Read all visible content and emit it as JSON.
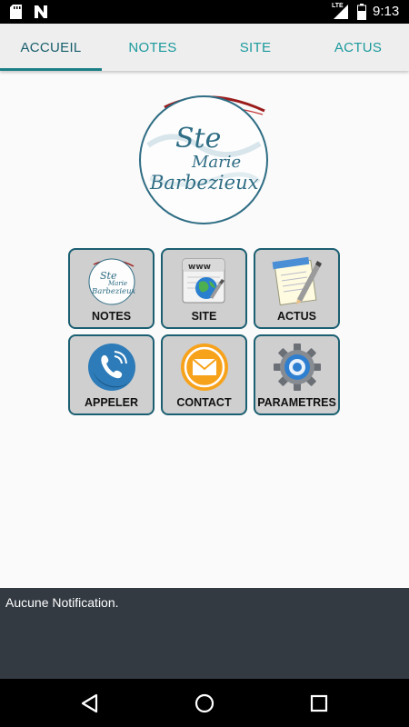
{
  "status_bar": {
    "time": "9:13",
    "network": "LTE",
    "icons": [
      "sd-card-icon",
      "n-notification-icon",
      "signal-icon",
      "battery-icon"
    ]
  },
  "tabs": [
    {
      "label": "ACCUEIL",
      "active": true
    },
    {
      "label": "NOTES",
      "active": false
    },
    {
      "label": "SITE",
      "active": false
    },
    {
      "label": "ACTUS",
      "active": false
    }
  ],
  "logo": {
    "line1": "Ste",
    "line2": "Marie",
    "line3": "Barbezieux"
  },
  "tiles": [
    {
      "label": "NOTES",
      "icon": "school-logo-icon"
    },
    {
      "label": "SITE",
      "icon": "www-globe-icon"
    },
    {
      "label": "ACTUS",
      "icon": "notepad-pencil-icon"
    },
    {
      "label": "APPELER",
      "icon": "phone-icon"
    },
    {
      "label": "CONTACT",
      "icon": "envelope-icon"
    },
    {
      "label": "PARAMETRES",
      "icon": "gear-icon"
    }
  ],
  "notification": {
    "text": "Aucune Notification."
  },
  "colors": {
    "accent": "#1c9a9d",
    "accent_dark": "#175e6b",
    "tile_border": "#1b5f72",
    "tile_bg": "#cfcfcf",
    "notification_bg": "#333a42"
  }
}
